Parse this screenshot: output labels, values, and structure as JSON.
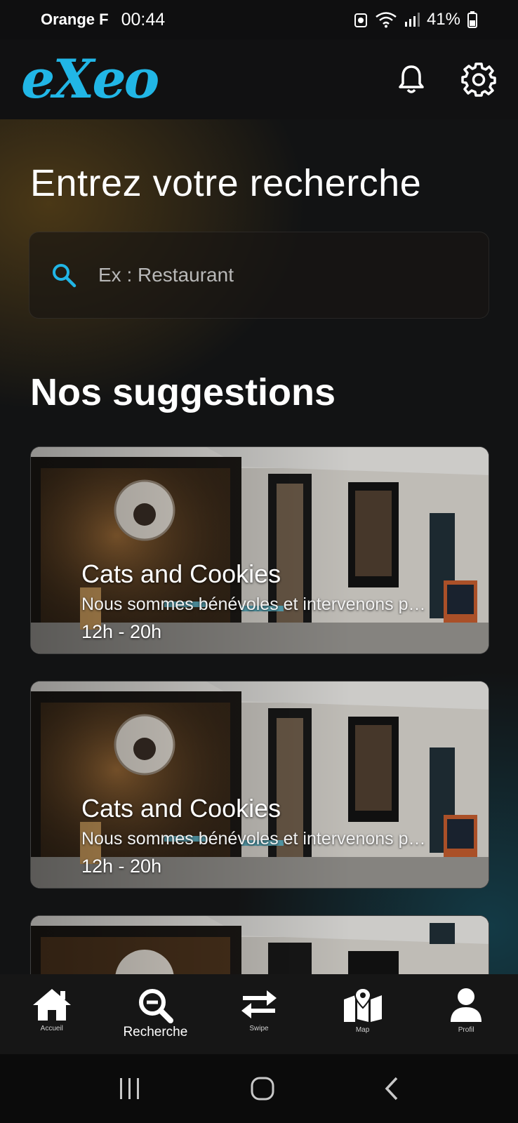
{
  "status_bar": {
    "carrier": "Orange F",
    "time": "00:44",
    "battery": "41%"
  },
  "header": {
    "logo": "eXeo",
    "icons": [
      "bell-icon",
      "gear-icon"
    ]
  },
  "search": {
    "title": "Entrez votre recherche",
    "placeholder": "Ex : Restaurant",
    "icon": "search-icon"
  },
  "suggestions": {
    "title": "Nos suggestions",
    "cards": [
      {
        "name": "Cats and Cookies",
        "description": "Nous sommes bénévoles et intervenons pour la protection des chats",
        "hours": "12h - 20h"
      },
      {
        "name": "Cats and Cookies",
        "description": "Nous sommes bénévoles et intervenons pour la protection des chats",
        "hours": "12h - 20h"
      },
      {
        "name": "",
        "description": "",
        "hours": ""
      }
    ]
  },
  "bottom_nav": {
    "items": [
      {
        "label": "Accueil",
        "icon": "home-icon"
      },
      {
        "label": "Recherche",
        "icon": "search-minus-icon",
        "active": true
      },
      {
        "label": "Swipe",
        "icon": "swap-arrows-icon"
      },
      {
        "label": "Map",
        "icon": "map-icon"
      },
      {
        "label": "Profil",
        "icon": "user-icon"
      }
    ]
  },
  "colors": {
    "accent": "#21b6e6",
    "background": "#121314",
    "nav": "#161616"
  }
}
